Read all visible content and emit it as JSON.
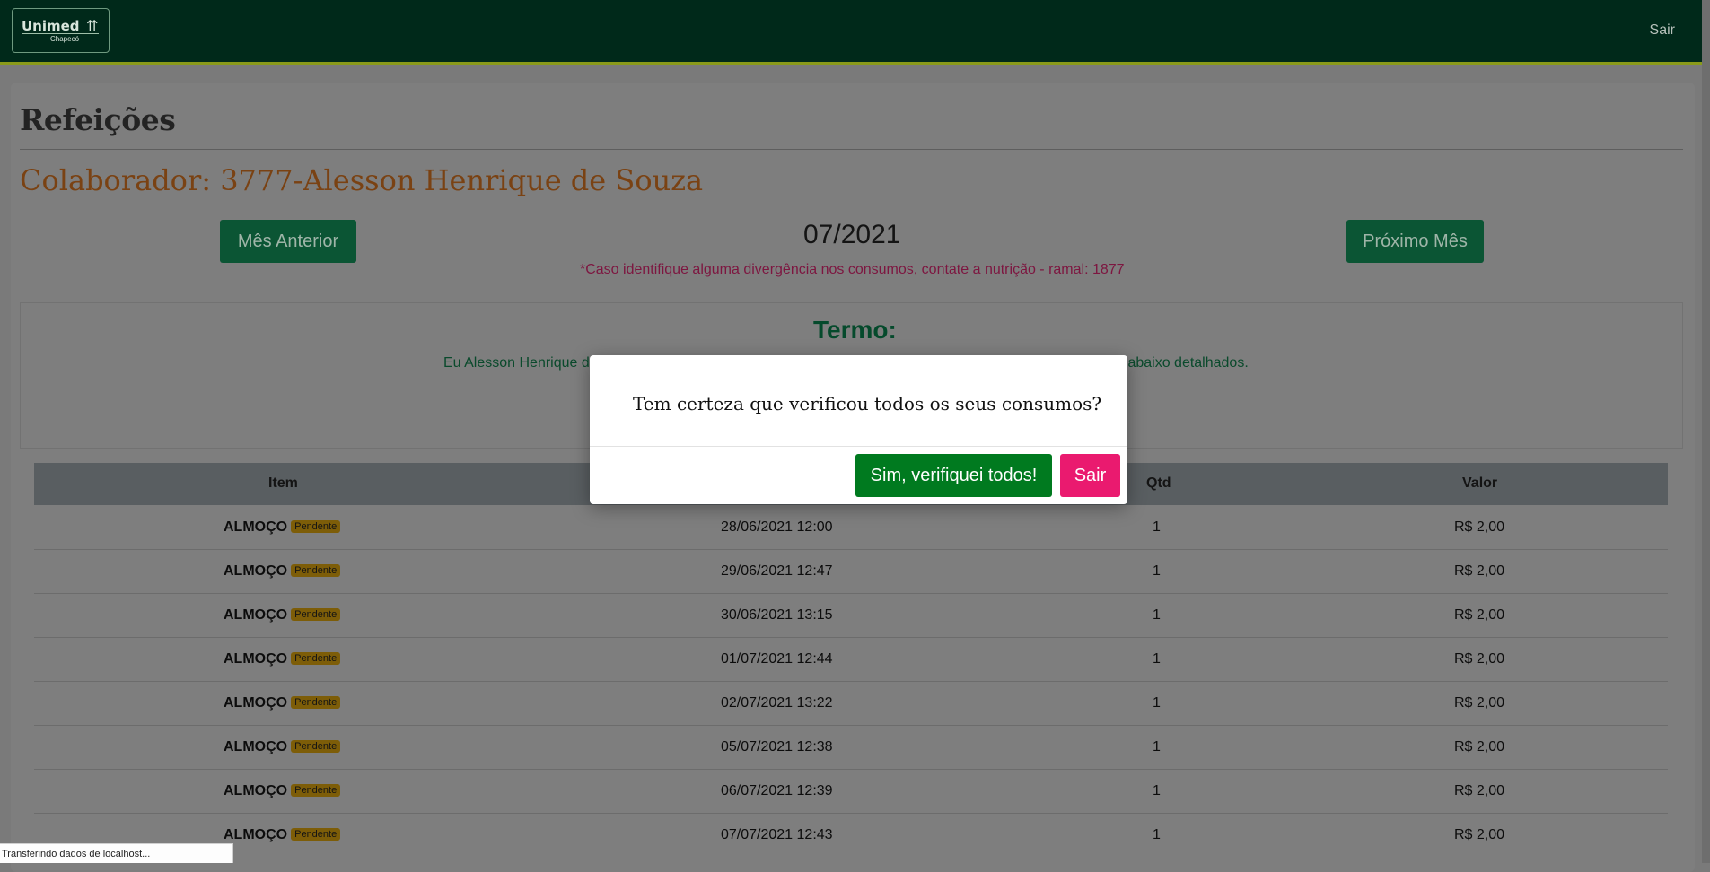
{
  "header": {
    "logo_name": "Unimed",
    "logo_sub": "Chapecó",
    "logout_label": "Sair"
  },
  "page": {
    "title": "Refeições",
    "collaborator": "Colaborador: 3777-Alesson Henrique de Souza",
    "prev_month_label": "Mês Anterior",
    "next_month_label": "Próximo Mês",
    "current_month": "07/2021",
    "warning": "*Caso identifique alguma divergência nos consumos, contate a nutrição - ramal: 1877"
  },
  "termo": {
    "title": "Termo:",
    "text_visible_left": "Eu Alesson Henrique d",
    "text_visible_right": "s abaixo detalhados."
  },
  "table": {
    "columns": [
      "Item",
      "Qtd",
      "Valor"
    ],
    "rows": [
      {
        "item": "ALMOÇO",
        "status": "Pendente",
        "datetime": "28/06/2021 12:00",
        "qtd": "1",
        "valor": "R$ 2,00"
      },
      {
        "item": "ALMOÇO",
        "status": "Pendente",
        "datetime": "29/06/2021 12:47",
        "qtd": "1",
        "valor": "R$ 2,00"
      },
      {
        "item": "ALMOÇO",
        "status": "Pendente",
        "datetime": "30/06/2021 13:15",
        "qtd": "1",
        "valor": "R$ 2,00"
      },
      {
        "item": "ALMOÇO",
        "status": "Pendente",
        "datetime": "01/07/2021 12:44",
        "qtd": "1",
        "valor": "R$ 2,00"
      },
      {
        "item": "ALMOÇO",
        "status": "Pendente",
        "datetime": "02/07/2021 13:22",
        "qtd": "1",
        "valor": "R$ 2,00"
      },
      {
        "item": "ALMOÇO",
        "status": "Pendente",
        "datetime": "05/07/2021 12:38",
        "qtd": "1",
        "valor": "R$ 2,00"
      },
      {
        "item": "ALMOÇO",
        "status": "Pendente",
        "datetime": "06/07/2021 12:39",
        "qtd": "1",
        "valor": "R$ 2,00"
      },
      {
        "item": "ALMOÇO",
        "status": "Pendente",
        "datetime": "07/07/2021 12:43",
        "qtd": "1",
        "valor": "R$ 2,00"
      }
    ]
  },
  "modal": {
    "question": "Tem certeza que verificou todos os seus consumos?",
    "confirm_label": "Sim, verifiquei todos!",
    "cancel_label": "Sair"
  },
  "statusbar": {
    "text": "Transferindo dados de localhost..."
  },
  "colors": {
    "header_bg": "#00291a",
    "primary_green": "#0b5534",
    "confirm_green": "#007a1f",
    "cancel_pink": "#ea1a6f",
    "badge_yellow": "#f1b90f",
    "collaborator_orange": "#c2661a"
  }
}
